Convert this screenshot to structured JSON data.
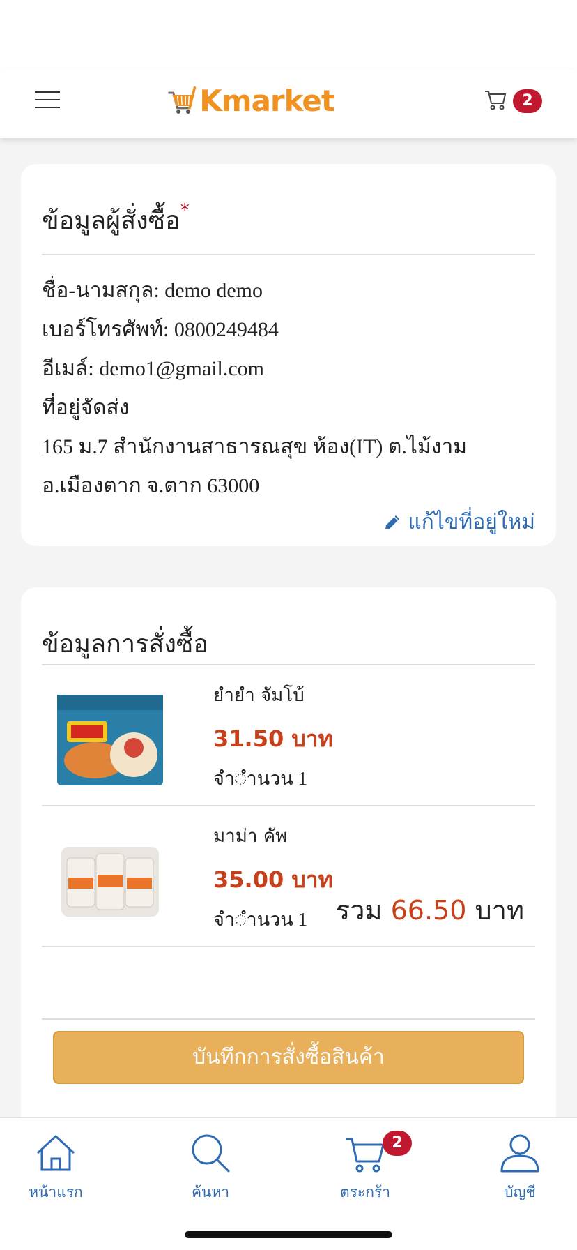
{
  "app": {
    "brand": "Kmarket",
    "cart_count": "2"
  },
  "buyer": {
    "title": "ข้อมูลผู้สั่งซื้อ",
    "required_mark": "*",
    "name_line": "ชื่อ-นามสกุล: demo demo",
    "phone_line": "เบอร์โทรศัพท์: 0800249484",
    "email_line": "อีเมล์: demo1@gmail.com",
    "address_heading": "ที่อยู่จัดส่ง",
    "address_line1": "165 ม.7 สำนักงานสาธารณสุข ห้อง(IT) ต.ไม้งาม",
    "address_line2": "อ.เมืองตาก จ.ตาก 63000",
    "edit_label": "แก้ไขที่อยู่ใหม่"
  },
  "order": {
    "title": "ข้อมูลการสั่งซื้อ",
    "items": [
      {
        "name": "ยำยำ จัมโบ้",
        "price": "31.50 บาท",
        "qty": "จำ◌ำนวน 1"
      },
      {
        "name": "มาม่า คัพ",
        "price": "35.00 บาท",
        "qty": "จำ◌ำนวน 1"
      }
    ],
    "total_label": "รวม",
    "total_value": "66.50",
    "total_unit": "บาท",
    "save_label": "บันทึกการสั่งซื้อสินค้า"
  },
  "nav": {
    "home": "หน้าแรก",
    "search": "ค้นหา",
    "cart": "ตระกร้า",
    "cart_count": "2",
    "account": "บัญชี"
  },
  "colors": {
    "brand_orange": "#f09221",
    "link_blue": "#2f6bb3",
    "price_red": "#c8401a",
    "badge_red": "#c0182f",
    "button_gold": "#e8b05a"
  }
}
